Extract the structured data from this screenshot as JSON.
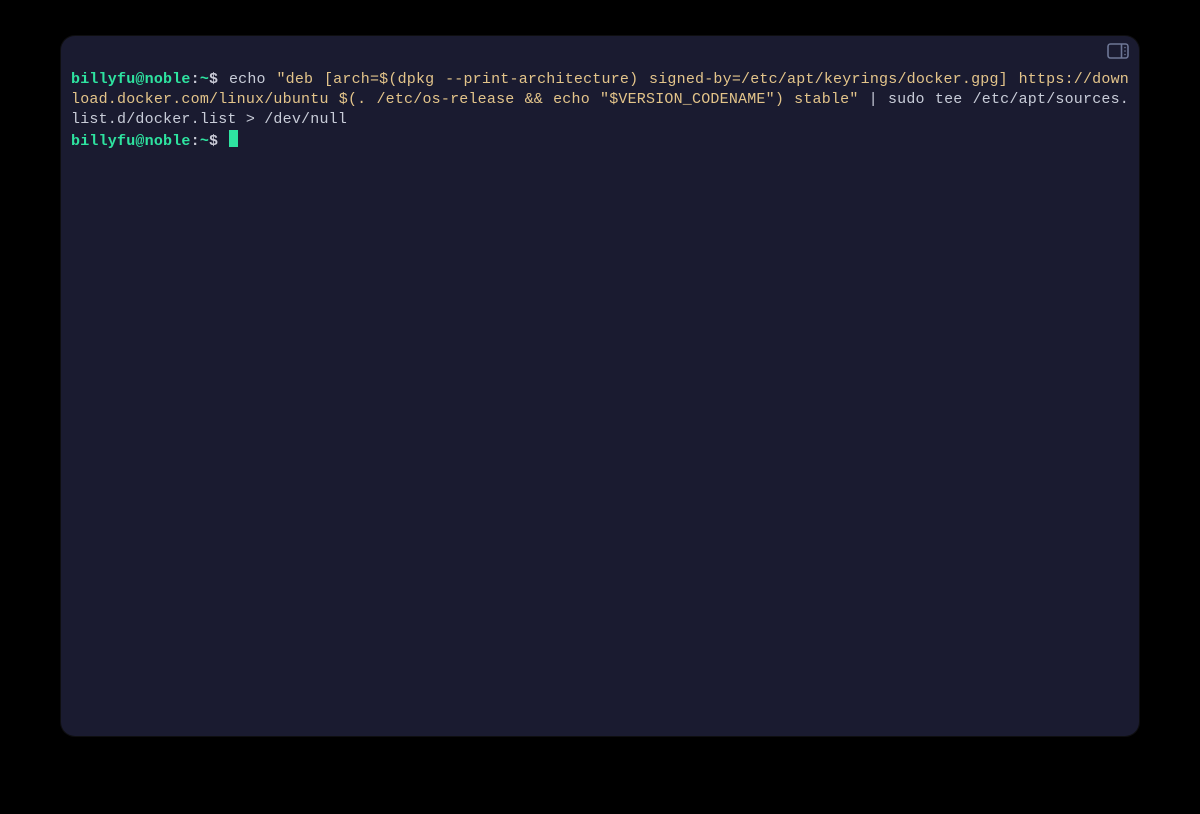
{
  "prompt": {
    "user_host": "billyfu@noble",
    "separator": ":",
    "path": "~",
    "symbol": "$"
  },
  "lines": [
    {
      "command_prefix": "echo ",
      "string_part": "\"deb [arch=$(dpkg --print-architecture) signed-by=/etc/apt/keyrings/docker.gpg] https://download.docker.com/linux/ubuntu $(. /etc/os-release && echo \"$VERSION_CODENAME\") stable\"",
      "command_suffix": " | sudo tee /etc/apt/sources.list.d/docker.list > /dev/null"
    }
  ]
}
